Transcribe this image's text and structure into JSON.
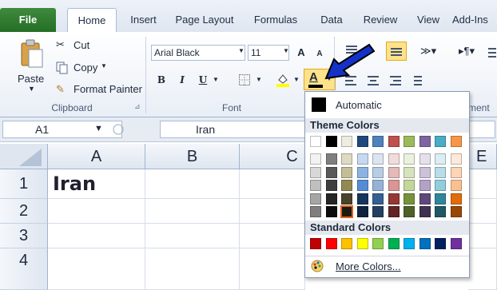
{
  "tabs": [
    {
      "label": "File"
    },
    {
      "label": "Home"
    },
    {
      "label": "Insert"
    },
    {
      "label": "Page Layout"
    },
    {
      "label": "Formulas"
    },
    {
      "label": "Data"
    },
    {
      "label": "Review"
    },
    {
      "label": "View"
    },
    {
      "label": "Add-Ins"
    }
  ],
  "clipboard": {
    "paste": "Paste",
    "cut": "Cut",
    "copy": "Copy",
    "format_painter": "Format Painter",
    "group": "Clipboard"
  },
  "font": {
    "name": "Arial Black",
    "size": "11",
    "grow": "A",
    "shrink": "A",
    "bold": "B",
    "italic": "I",
    "underline": "U",
    "color_letter": "A",
    "group": "Font"
  },
  "alignment_group_fragment": "ment",
  "formula": {
    "namebox": "A1",
    "fx": "fx",
    "value": "Iran"
  },
  "columns": [
    "A",
    "B",
    "C",
    "E"
  ],
  "rows": [
    "1",
    "2",
    "3",
    "4"
  ],
  "cells": {
    "A1": "Iran"
  },
  "color_menu": {
    "automatic": "Automatic",
    "theme_header": "Theme Colors",
    "standard_header": "Standard Colors",
    "more": "More Colors...",
    "theme_top": [
      "#ffffff",
      "#000000",
      "#eeece1",
      "#1f497d",
      "#4f81bd",
      "#c0504d",
      "#9bbb59",
      "#8064a2",
      "#4bacc6",
      "#f79646"
    ],
    "theme_shades": [
      [
        "#f2f2f2",
        "#7f7f7f",
        "#ddd9c3",
        "#c6d9f0",
        "#dbe5f1",
        "#f2dcdb",
        "#ebf1dd",
        "#e5e0ec",
        "#dbeef3",
        "#fdeada"
      ],
      [
        "#d8d8d8",
        "#595959",
        "#c4bd97",
        "#8db3e2",
        "#b8cce4",
        "#e5b9b7",
        "#d7e3bc",
        "#ccc1d9",
        "#b7dde8",
        "#fbd5b5"
      ],
      [
        "#bfbfbf",
        "#3f3f3f",
        "#938953",
        "#548dd4",
        "#95b3d7",
        "#d99694",
        "#c3d69b",
        "#b2a2c7",
        "#92cddc",
        "#fac08f"
      ],
      [
        "#a5a5a5",
        "#262626",
        "#494429",
        "#17365d",
        "#366092",
        "#953734",
        "#76923c",
        "#5f497a",
        "#31859b",
        "#e36c09"
      ],
      [
        "#7f7f7f",
        "#0c0c0c",
        "#1d1b10",
        "#0f243e",
        "#244061",
        "#632423",
        "#4f6128",
        "#3f3151",
        "#205867",
        "#974806"
      ]
    ],
    "standard": [
      "#c00000",
      "#ff0000",
      "#ffc000",
      "#ffff00",
      "#92d050",
      "#00b050",
      "#00b0f0",
      "#0070c0",
      "#002060",
      "#7030a0"
    ],
    "selected_shade": {
      "row": 4,
      "col": 2
    }
  },
  "arrow_color": "#1432c8"
}
